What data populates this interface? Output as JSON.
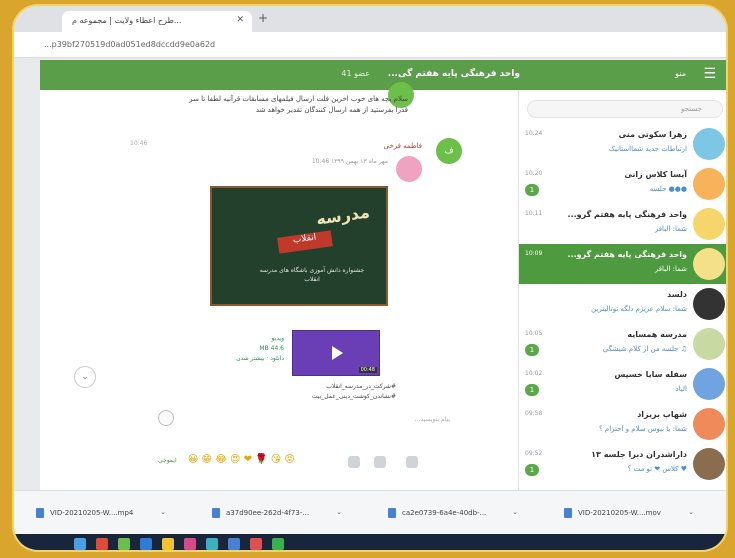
{
  "browser": {
    "tab_title": "طرح اعطاء ولایت | مجموعه م...",
    "tab_close": "✕",
    "new_tab": "+",
    "address": "...p39bf270519d0ad051ed8dccdd9e0a62d"
  },
  "topbar": {
    "title": "واحد فرهنگی پایه هفتم گی...",
    "member_badge": "41 عضو",
    "menu_label": "منو",
    "menu_icon": "☰"
  },
  "sidebar": {
    "search_placeholder": "جستجو",
    "items": [
      {
        "name": "زهرا سکوتی منی",
        "sub": "ارتباطات جدید شمااستاتیک",
        "time": "10:24",
        "count": "",
        "color": "#7ec6e6"
      },
      {
        "name": "آیسا کلاس زانی",
        "sub": "●●● جلسه",
        "time": "10:20",
        "count": "1",
        "color": "#f7b25a"
      },
      {
        "name": "واحد فرهنگی پایه هفتم گرو...",
        "sub": "شما: الباقر",
        "time": "10:11",
        "count": "",
        "color": "#f6d66a"
      },
      {
        "name": "واحد فرهنگی پایه هفتم گرو...",
        "sub": "شما: الباقر",
        "time": "10:09",
        "count": "",
        "color": "#f5e08a",
        "active": true
      },
      {
        "name": "دلسد",
        "sub": "شما: سلام عزیزم دلگه توتالیترین",
        "time": "",
        "count": "",
        "color": "#333333"
      },
      {
        "name": "مدرسه همسایه",
        "sub": "♫ جلسه من از کلام شیشگی",
        "time": "10:05",
        "count": "1",
        "color": "#c8d9a2"
      },
      {
        "name": "سفله سایا خسیس",
        "sub": "الیاد",
        "time": "10:02",
        "count": "1",
        "color": "#6fa4e0"
      },
      {
        "name": "شهاب بریزاد",
        "sub": "شما: یا نبوس سلام و احترام ؟",
        "time": "09:58",
        "count": "",
        "color": "#f08a5a"
      },
      {
        "name": "داراشدران دبرا جلسه ۱۳",
        "sub": "♥ کلاس ❤ تو مت ؟",
        "time": "09:52",
        "count": "1",
        "color": "#8a6d4e"
      }
    ]
  },
  "chat": {
    "prev_message": "سلام بچه های خوب اخرین فلت ارسال فیلمهای مسابقات قرآنیه لطفا تا سر قدرا بفرستید از همه ارسال کنندگان تقدیر خواهد شد",
    "sender": "فاطمه فرخی",
    "meta": "مهر ماه ۱۳ بهمن ۱۳۹۹ 10:46",
    "timestamp_left": "10:46",
    "avatar_label": "ف",
    "poster_title": "مدرسه",
    "poster_word": "انقلاب",
    "poster_text": "جشنواره دانش آموزی باشگاه های مدرسه انقلاب",
    "video_duration": "00:48",
    "video_size": "44.6 MB",
    "video_status": "دانلود · بیشتر شدن",
    "video_label": "ویدیو",
    "caption_line1": "#شرکت_در_مدرسه_انقلاب",
    "caption_line2": "#نشاندن_کوشت_دینی_عمل_بیت",
    "compose_placeholder": "پیام بنویسید...",
    "scroll_down_icon": "⌄",
    "emoji_label": "ایموجی",
    "reactions": [
      "😀",
      "😁",
      "😂",
      "😍",
      "❤",
      "🌹",
      "😘",
      "😡"
    ]
  },
  "downloads": [
    {
      "name": "VID-20210205-W....mp4"
    },
    {
      "name": "a37d90ee-262d-4f73-..."
    },
    {
      "name": "ca2e0739-6a4e-40db-..."
    },
    {
      "name": "VID-20210205-W....mov"
    }
  ],
  "colors": {
    "accent": "#5a9e4a",
    "active_item": "#4e9a3e",
    "badge": "#5aa84a"
  }
}
